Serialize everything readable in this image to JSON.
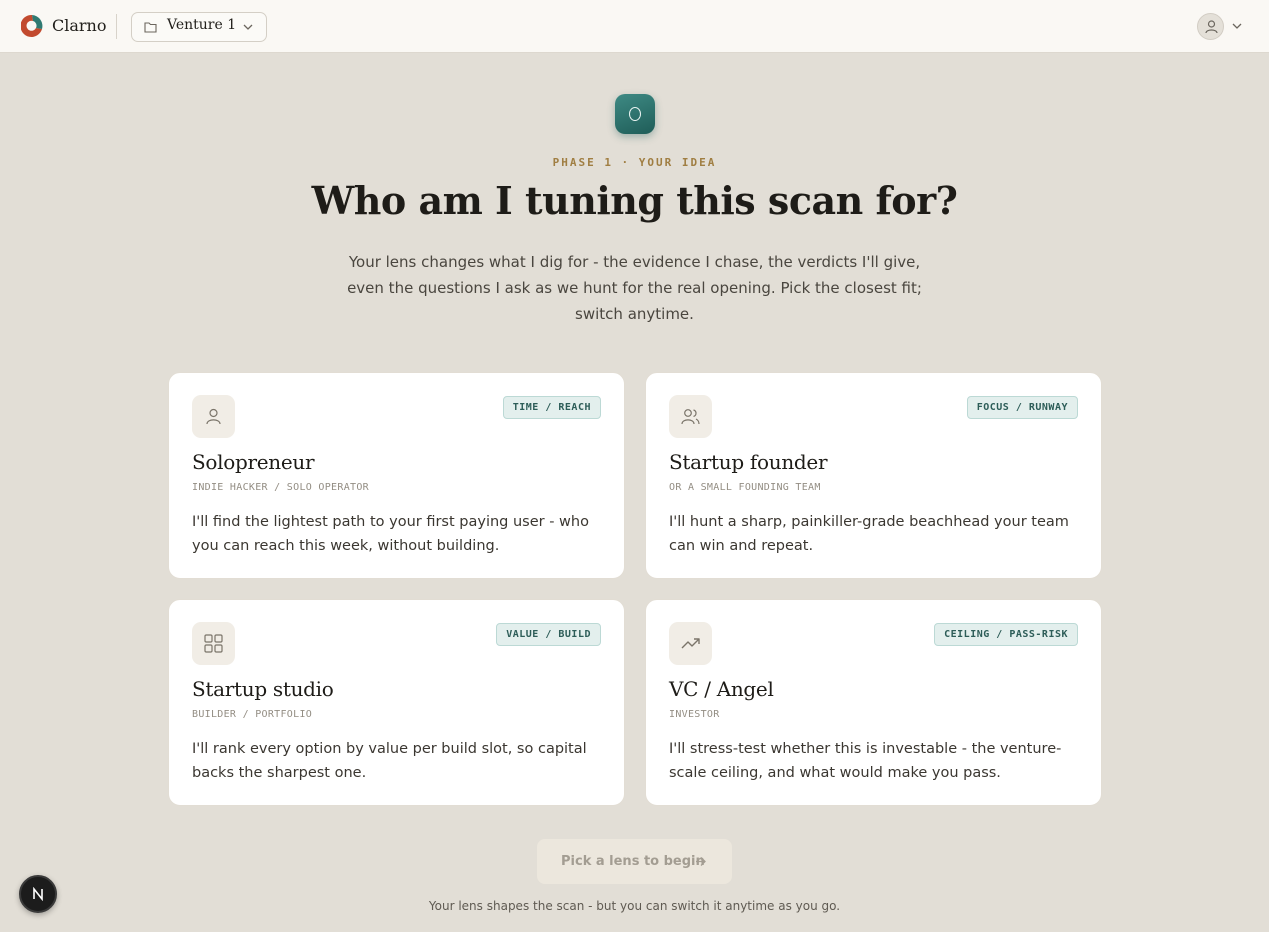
{
  "app": {
    "brand": "Clarno",
    "venture_name": "Venture 1"
  },
  "hero": {
    "phase_label": "PHASE 1 · YOUR IDEA",
    "title": "Who am I tuning this scan for?",
    "subtitle": "Your lens changes what I dig for - the evidence I chase, the verdicts I'll give, even the questions I ask as we hunt for the real opening. Pick the closest fit; switch anytime."
  },
  "lenses": [
    {
      "icon": "user-icon",
      "tag": "TIME / REACH",
      "name": "Solopreneur",
      "subtitle": "INDIE HACKER / SOLO OPERATOR",
      "description": "I'll find the lightest path to your first paying user - who you can reach this week, without building."
    },
    {
      "icon": "users-icon",
      "tag": "FOCUS / RUNWAY",
      "name": "Startup founder",
      "subtitle": "OR A SMALL FOUNDING TEAM",
      "description": "I'll hunt a sharp, painkiller-grade beachhead your team can win and repeat."
    },
    {
      "icon": "grid-icon",
      "tag": "VALUE / BUILD",
      "name": "Startup studio",
      "subtitle": "BUILDER / PORTFOLIO",
      "description": "I'll rank every option by value per build slot, so capital backs the sharpest one."
    },
    {
      "icon": "trending-up-icon",
      "tag": "CEILING / PASS-RISK",
      "name": "VC / Angel",
      "subtitle": "INVESTOR",
      "description": "I'll stress-test whether this is investable - the venture-scale ceiling, and what would make you pass."
    }
  ],
  "cta": {
    "label": "Pick a lens to begin",
    "footnote": "Your lens shapes the scan - but you can switch it anytime as you go."
  },
  "colors": {
    "background": "#e2ded6",
    "accent_teal": "#2d6e69",
    "phase_gold": "#a07e42"
  }
}
